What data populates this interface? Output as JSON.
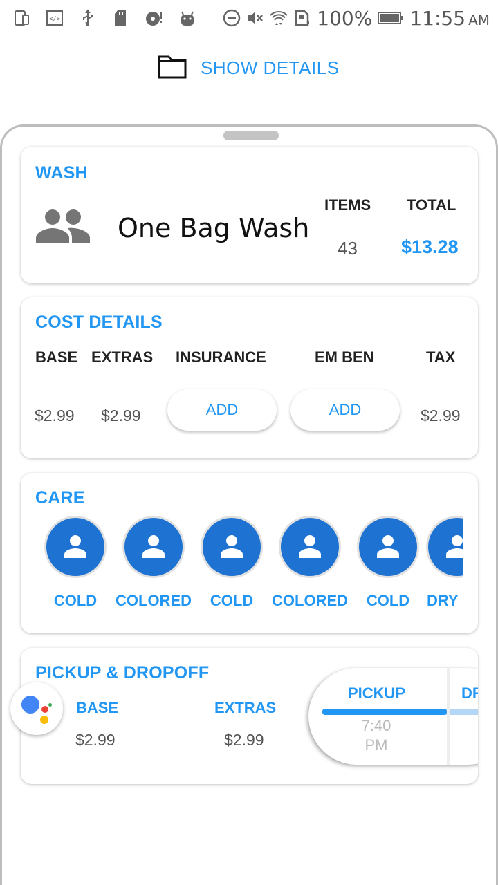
{
  "status_bar": {
    "battery": "100%",
    "time": "11:55",
    "ampm": "AM",
    "icons": [
      "tablet-icon",
      "code-icon",
      "usb-icon",
      "sdcard-icon",
      "disc-icon",
      "android-icon",
      "dnd-icon",
      "mute-icon",
      "wifi-icon",
      "sim-icon",
      "battery-icon"
    ]
  },
  "header": {
    "show_details_label": "SHOW DETAILS",
    "icon": "folder-icon"
  },
  "wash": {
    "title": "WASH",
    "icon": "people-icon",
    "name": "One Bag Wash",
    "items_label": "ITEMS",
    "items_value": "43",
    "total_label": "TOTAL",
    "total_value": "$13.28"
  },
  "cost_details": {
    "title": "COST DETAILS",
    "headers": [
      "BASE",
      "EXTRAS",
      "INSURANCE",
      "EM BEN",
      "TAX"
    ],
    "base_value": "$2.99",
    "extras_value": "$2.99",
    "insurance_button": "ADD",
    "em_ben_button": "ADD",
    "tax_value": "$2.99"
  },
  "care": {
    "title": "CARE",
    "items": [
      {
        "label": "COLD"
      },
      {
        "label": "COLORED"
      },
      {
        "label": "COLD"
      },
      {
        "label": "COLORED"
      },
      {
        "label": "COLD"
      },
      {
        "label": "DRY"
      }
    ]
  },
  "pickup_dropoff": {
    "title": "PICKUP & DROPOFF",
    "base_label": "BASE",
    "base_value": "$2.99",
    "extras_label": "EXTRAS",
    "extras_value": "$2.99",
    "pickup_label": "PICKUP",
    "dropoff_label": "DROPOFF",
    "pickup_time": "7:40",
    "pickup_ampm": "PM"
  },
  "colors": {
    "accent": "#2196F3",
    "care_circle": "#1E73D2"
  }
}
